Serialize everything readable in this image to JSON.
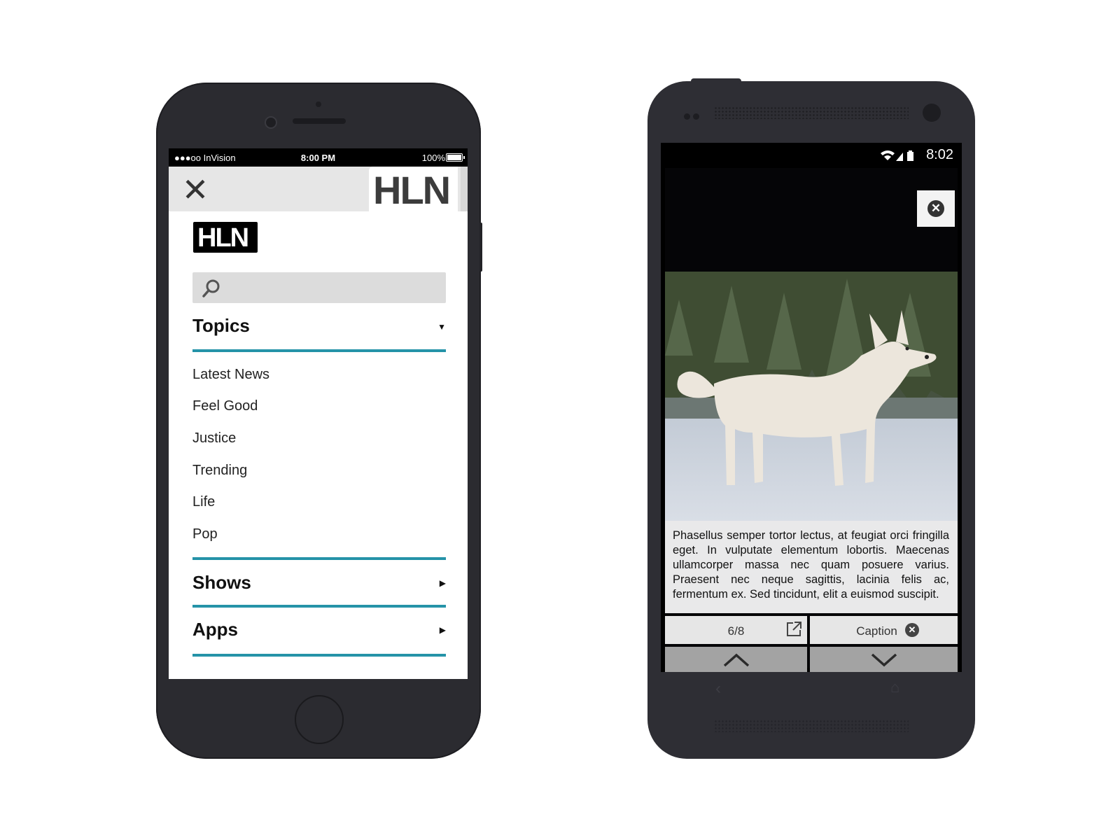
{
  "iphone": {
    "status": {
      "carrier": "●●●oo InVision",
      "time": "8:00 PM",
      "battery": "100%"
    },
    "header": {
      "close_glyph": "✕",
      "brand": "HLN"
    },
    "menu_logo": "HLN",
    "search": {
      "placeholder": ""
    },
    "sections": [
      {
        "label": "Topics",
        "state": "expanded"
      },
      {
        "label": "Shows",
        "state": "collapsed"
      },
      {
        "label": "Apps",
        "state": "collapsed"
      }
    ],
    "topics": [
      "Latest News",
      "Feel Good",
      "Justice",
      "Trending",
      "Life",
      "Pop"
    ]
  },
  "android": {
    "status": {
      "time": "8:02"
    },
    "gallery": {
      "caption_text": "Phasellus semper tortor lectus, at feugiat orci fringilla eget. In vulputate elementum lobortis. Maecenas ullamcorper massa nec quam posuere varius. Praesent nec neque sagittis, lacinia felis ac, fermentum ex. Sed tincidunt, elit a euismod suscipit.",
      "counter": "6/8",
      "caption_button": "Caption",
      "close_glyph": "✕"
    }
  },
  "colors": {
    "accent_rule": "#2593a8",
    "device_body": "#2b2b30"
  }
}
